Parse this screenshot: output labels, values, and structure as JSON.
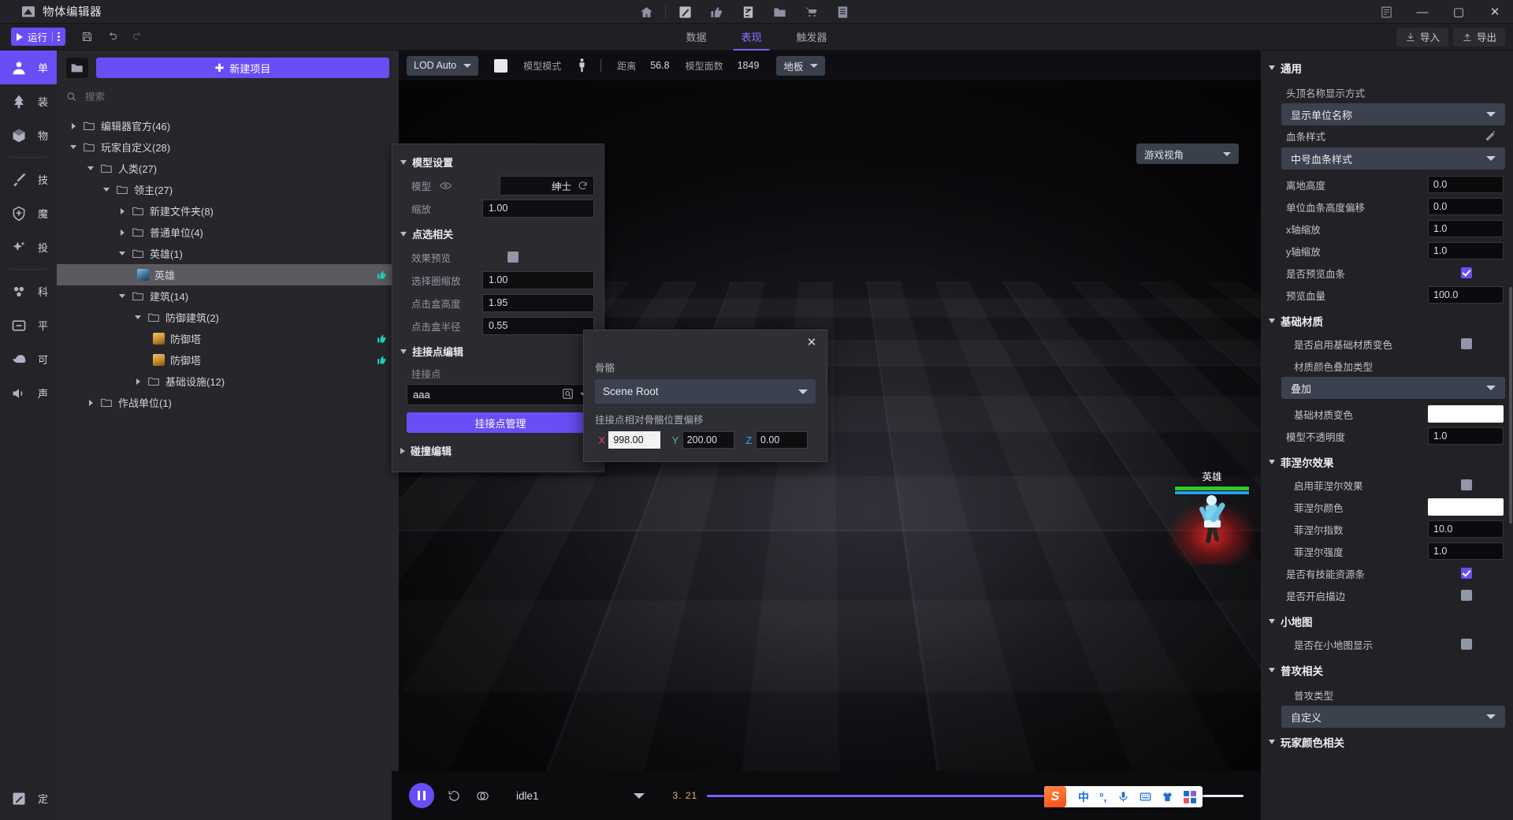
{
  "window": {
    "title": "物体编辑器",
    "logo_icon": "editor-logo-icon",
    "minimize": "—",
    "maximize": "▢",
    "close": "✕"
  },
  "titlebar_icons": [
    {
      "name": "home-icon",
      "glyph": "home"
    },
    {
      "name": "brush-icon",
      "glyph": "brush"
    },
    {
      "name": "thumbs-up-icon",
      "glyph": "thumb"
    },
    {
      "name": "note-edit-icon",
      "glyph": "note"
    },
    {
      "name": "folder-icon",
      "glyph": "folder"
    },
    {
      "name": "cart-icon",
      "glyph": "cart"
    },
    {
      "name": "list-icon",
      "glyph": "list"
    }
  ],
  "actionbar": {
    "run_label": "运行",
    "save_icon": "save-icon",
    "undo_icon": "undo-icon",
    "redo_icon": "redo-icon",
    "tabs": [
      {
        "label": "数据",
        "active": false
      },
      {
        "label": "表现",
        "active": true
      },
      {
        "label": "触发器",
        "active": false
      }
    ],
    "import_label": "导入",
    "export_label": "导出"
  },
  "rail": {
    "items": [
      {
        "label": "单",
        "icon": "person-icon",
        "active": true
      },
      {
        "label": "装",
        "icon": "tree-icon",
        "active": false
      },
      {
        "label": "物",
        "icon": "box-icon",
        "active": false
      },
      {
        "label": "技",
        "icon": "sword-icon",
        "active": false
      },
      {
        "label": "魔",
        "icon": "shield-icon",
        "active": false
      },
      {
        "label": "投",
        "icon": "sparkle-icon",
        "active": false
      },
      {
        "label": "科",
        "icon": "nodes-icon",
        "active": false
      },
      {
        "label": "平",
        "icon": "drawer-icon",
        "active": false
      },
      {
        "label": "可",
        "icon": "hat-icon",
        "active": false
      },
      {
        "label": "声",
        "icon": "speaker-icon",
        "active": false
      }
    ],
    "bottom": {
      "label": "定",
      "icon": "pen-square-icon"
    }
  },
  "tree_panel": {
    "folder_icon": "folder-open-icon",
    "new_project_label": "新建项目",
    "search_placeholder": "搜索",
    "search_value": "",
    "nodes": [
      {
        "label": "编辑器官方(46)",
        "depth": 0,
        "expanded": false,
        "icon": "folder-icon"
      },
      {
        "label": "玩家自定义(28)",
        "depth": 0,
        "expanded": true,
        "icon": "folder-icon"
      },
      {
        "label": "人类(27)",
        "depth": 1,
        "expanded": true,
        "icon": "folder-icon"
      },
      {
        "label": "领主(27)",
        "depth": 2,
        "expanded": true,
        "icon": "folder-icon"
      },
      {
        "label": "新建文件夹(8)",
        "depth": 3,
        "expanded": false,
        "icon": "folder-icon"
      },
      {
        "label": "普通单位(4)",
        "depth": 3,
        "expanded": false,
        "icon": "folder-icon"
      },
      {
        "label": "英雄(1)",
        "depth": 3,
        "expanded": true,
        "icon": "folder-icon"
      },
      {
        "label": "英雄",
        "depth": 4,
        "leaf": true,
        "selected": true,
        "icon": "hero-thumb",
        "flag": "thumb-icon"
      },
      {
        "label": "建筑(14)",
        "depth": 3,
        "expanded": true,
        "icon": "folder-icon"
      },
      {
        "label": "防御建筑(2)",
        "depth": 4,
        "expanded": true,
        "icon": "folder-icon"
      },
      {
        "label": "防御塔",
        "depth": 5,
        "leaf": true,
        "icon": "tower-thumb",
        "flag": "thumb-icon"
      },
      {
        "label": "防御塔",
        "depth": 5,
        "leaf": true,
        "icon": "tower-thumb",
        "flag": "thumb-icon"
      },
      {
        "label": "基础设施(12)",
        "depth": 4,
        "expanded": false,
        "icon": "folder-icon"
      },
      {
        "label": "作战单位(1)",
        "depth": 1,
        "expanded": false,
        "icon": "folder-icon"
      }
    ]
  },
  "viewport": {
    "toolbar": {
      "lod_label": "LOD Auto",
      "color_swatch": "#e8e8ea",
      "mode_label": "模型模式",
      "figure_icon": "humanoid-icon",
      "distance_label": "距离",
      "distance_value": "56.8",
      "faces_label": "模型面数",
      "faces_value": "1849",
      "floor_label": "地板"
    },
    "view_mode": "游戏视角",
    "character": {
      "name": "英雄",
      "hp_color": "#2fc62f",
      "mp_color": "#2a9ee6",
      "hp_percent": 100,
      "mp_percent": 100
    },
    "gizmo_icon": "axis-gizmo-icon"
  },
  "model_panel": {
    "sections": {
      "model_settings": "模型设置",
      "pick_related": "点选相关",
      "attach_edit": "挂接点编辑",
      "collide_edit": "碰撞编辑"
    },
    "model_label": "模型",
    "model_value": "绅士",
    "eye_icon": "eye-icon",
    "refresh_icon": "refresh-icon",
    "scale_label": "缩放",
    "scale_value": "1.00",
    "effect_preview_label": "效果预览",
    "effect_preview_checked": false,
    "select_ring_label": "选择圈缩放",
    "select_ring_value": "1.00",
    "click_box_h_label": "点击盒高度",
    "click_box_h_value": "1.95",
    "click_box_r_label": "点击盒半径",
    "click_box_r_value": "0.55",
    "attach_point_label": "挂接点",
    "attach_point_value": "aaa",
    "attach_manage_label": "挂接点管理",
    "search_icon": "magnifier-icon"
  },
  "attach_dialog": {
    "close_icon": "close-icon",
    "bone_label": "骨骼",
    "bone_value": "Scene Root",
    "offset_label": "挂接点相对骨骼位置偏移",
    "axes": [
      {
        "axis": "X",
        "value": "998.00",
        "selected": true
      },
      {
        "axis": "Y",
        "value": "200.00",
        "selected": false
      },
      {
        "axis": "Z",
        "value": "0.00",
        "selected": false
      }
    ]
  },
  "inspector": {
    "groups": [
      {
        "title": "通用",
        "rows": [
          {
            "type": "label",
            "label": "头顶名称显示方式"
          },
          {
            "type": "combo",
            "value": "显示单位名称"
          },
          {
            "type": "label_pen",
            "label": "血条样式",
            "icon": "pencil-icon"
          },
          {
            "type": "combo",
            "value": "中号血条样式"
          },
          {
            "type": "field",
            "label": "离地高度",
            "value": "0.0"
          },
          {
            "type": "field",
            "label": "单位血条高度偏移",
            "value": "0.0"
          },
          {
            "type": "field",
            "label": "x轴缩放",
            "value": "1.0"
          },
          {
            "type": "field",
            "label": "y轴缩放",
            "value": "1.0"
          },
          {
            "type": "check",
            "label": "是否预览血条",
            "checked": true
          },
          {
            "type": "field",
            "label": "预览血量",
            "value": "100.0"
          }
        ]
      },
      {
        "title": "基础材质",
        "rows": [
          {
            "type": "check",
            "label": "是否启用基础材质变色",
            "checked": false,
            "indent": true
          },
          {
            "type": "label",
            "label": "材质颜色叠加类型",
            "indent": true
          },
          {
            "type": "combo",
            "value": "叠加"
          },
          {
            "type": "color",
            "label": "基础材质变色",
            "value": "#ffffff",
            "indent": true
          },
          {
            "type": "field",
            "label": "模型不透明度",
            "value": "1.0"
          }
        ]
      },
      {
        "title": "菲涅尔效果",
        "rows": [
          {
            "type": "check",
            "label": "启用菲涅尔效果",
            "checked": false,
            "indent": true
          },
          {
            "type": "color",
            "label": "菲涅尔颜色",
            "value": "#ffffff",
            "indent": true
          },
          {
            "type": "field",
            "label": "菲涅尔指数",
            "value": "10.0",
            "indent": true
          },
          {
            "type": "field",
            "label": "菲涅尔强度",
            "value": "1.0",
            "indent": true
          },
          {
            "type": "check",
            "label": "是否有技能资源条",
            "checked": true
          },
          {
            "type": "check",
            "label": "是否开启描边",
            "checked": false
          }
        ]
      },
      {
        "title": "小地图",
        "rows": [
          {
            "type": "check",
            "label": "是否在小地图显示",
            "checked": false,
            "indent": true
          }
        ]
      },
      {
        "title": "普攻相关",
        "rows": [
          {
            "type": "label",
            "label": "普攻类型",
            "indent": true
          },
          {
            "type": "combo",
            "value": "自定义"
          }
        ]
      },
      {
        "title": "玩家颜色相关",
        "rows": []
      }
    ]
  },
  "playbar": {
    "play_icon": "pause-icon",
    "replay_icon": "replay-icon",
    "loop_icon": "loop-icon",
    "animation_name": "idle1",
    "dropdown_icon": "chevron-down-icon",
    "time_value": "3. 21",
    "progress_percent": 72
  },
  "ime": {
    "brand": "S",
    "items": [
      {
        "name": "ime-lang-toggle",
        "label": "中"
      },
      {
        "name": "ime-punct-toggle",
        "label": "°,"
      },
      {
        "name": "ime-voice-icon",
        "label": ""
      },
      {
        "name": "ime-keyboard-icon",
        "label": ""
      },
      {
        "name": "ime-skin-icon",
        "label": ""
      },
      {
        "name": "ime-apps-icon",
        "label": ""
      }
    ]
  }
}
